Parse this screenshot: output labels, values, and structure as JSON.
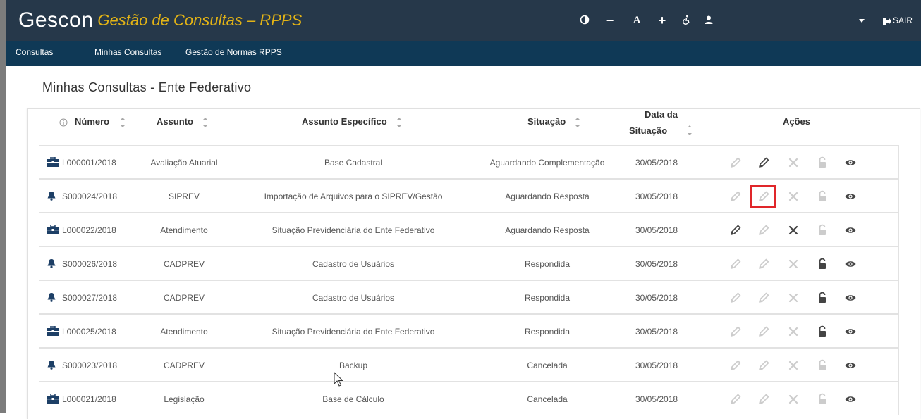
{
  "app": {
    "brand_name": "Gescon",
    "brand_subtitle": "Gestão de Consultas – RPPS",
    "tools": {
      "contrast_icon": "contrast-icon",
      "decrease_font": "−",
      "default_font": "A",
      "increase_font": "+",
      "accessibility_icon": "accessibility-icon",
      "user_icon": "user-icon",
      "dropdown_icon": "caret-down-icon"
    },
    "logout_label": "SAIR"
  },
  "nav": {
    "items": [
      {
        "label": "Consultas"
      },
      {
        "label": "Minhas Consultas"
      },
      {
        "label": "Gestão de Normas RPPS"
      }
    ]
  },
  "page": {
    "title": "Minhas Consultas - Ente Federativo"
  },
  "table": {
    "headers": {
      "numero": "Número",
      "assunto": "Assunto",
      "assunto_especifico": "Assunto Específico",
      "situacao": "Situação",
      "data_line1": "Data da",
      "data_line2": "Situação",
      "acoes": "Ações"
    },
    "rows": [
      {
        "icon": "briefcase-icon",
        "numero": "L000001/2018",
        "assunto": "Avaliação Atuarial",
        "assunto_especifico": "Base Cadastral",
        "situacao": "Aguardando Complementação",
        "data": "30/05/2018",
        "actions": {
          "edit1": false,
          "edit2": true,
          "cancel": false,
          "lock": false,
          "view": true
        }
      },
      {
        "icon": "bell-icon",
        "numero": "S000024/2018",
        "assunto": "SIPREV",
        "assunto_especifico": "Importação de Arquivos para o SIPREV/Gestão",
        "situacao": "Aguardando Resposta",
        "data": "30/05/2018",
        "actions": {
          "edit1": false,
          "edit2": false,
          "cancel": false,
          "lock": false,
          "view": true
        }
      },
      {
        "icon": "briefcase-icon",
        "numero": "L000022/2018",
        "assunto": "Atendimento",
        "assunto_especifico": "Situação Previdenciária do Ente Federativo",
        "situacao": "Aguardando Resposta",
        "data": "30/05/2018",
        "actions": {
          "edit1": true,
          "edit2": false,
          "cancel": true,
          "lock": false,
          "view": true
        }
      },
      {
        "icon": "bell-icon",
        "numero": "S000026/2018",
        "assunto": "CADPREV",
        "assunto_especifico": "Cadastro de Usuários",
        "situacao": "Respondida",
        "data": "30/05/2018",
        "actions": {
          "edit1": false,
          "edit2": false,
          "cancel": false,
          "lock": true,
          "view": true
        }
      },
      {
        "icon": "bell-icon",
        "numero": "S000027/2018",
        "assunto": "CADPREV",
        "assunto_especifico": "Cadastro de Usuários",
        "situacao": "Respondida",
        "data": "30/05/2018",
        "actions": {
          "edit1": false,
          "edit2": false,
          "cancel": false,
          "lock": true,
          "view": true
        }
      },
      {
        "icon": "briefcase-icon",
        "numero": "L000025/2018",
        "assunto": "Atendimento",
        "assunto_especifico": "Situação Previdenciária do Ente Federativo",
        "situacao": "Respondida",
        "data": "30/05/2018",
        "actions": {
          "edit1": false,
          "edit2": false,
          "cancel": false,
          "lock": true,
          "view": true
        }
      },
      {
        "icon": "bell-icon",
        "numero": "S000023/2018",
        "assunto": "CADPREV",
        "assunto_especifico": "Backup",
        "situacao": "Cancelada",
        "data": "30/05/2018",
        "actions": {
          "edit1": false,
          "edit2": false,
          "cancel": false,
          "lock": false,
          "view": true
        }
      },
      {
        "icon": "briefcase-icon",
        "numero": "L000021/2018",
        "assunto": "Legislação",
        "assunto_especifico": "Base de Cálculo",
        "situacao": "Cancelada",
        "data": "30/05/2018",
        "actions": {
          "edit1": false,
          "edit2": false,
          "cancel": false,
          "lock": false,
          "view": true
        }
      }
    ]
  },
  "colors": {
    "header_bg": "#26384a",
    "nav_bg": "#0f3956",
    "brand_subtitle": "#e2b316",
    "row_icon": "#1d3f66",
    "action_active": "#444444",
    "action_inactive": "#cccccc",
    "highlight": "#e0262a"
  }
}
